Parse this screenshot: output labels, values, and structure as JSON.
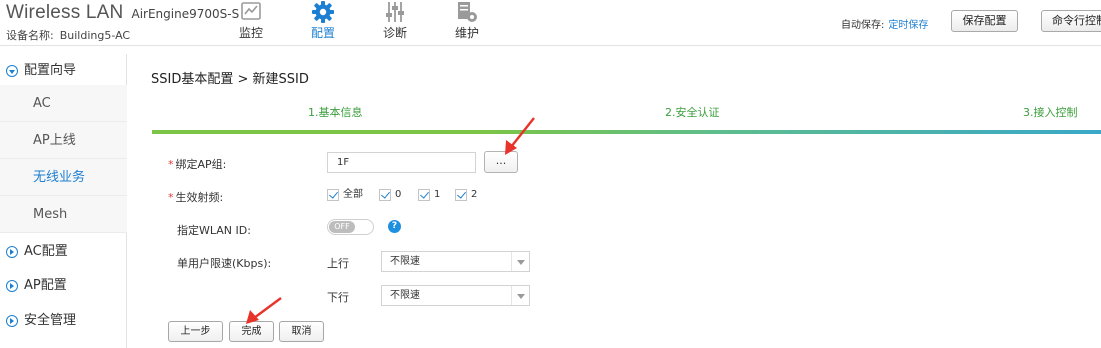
{
  "header": {
    "brand": "Wireless LAN",
    "model": "AirEngine9700S-S",
    "device_name_label": "设备名称:",
    "device_name": "Building5-AC",
    "nav": [
      {
        "label": "监控",
        "icon": "monitor-chart-icon"
      },
      {
        "label": "配置",
        "icon": "gear-icon",
        "active": true
      },
      {
        "label": "诊断",
        "icon": "sliders-icon"
      },
      {
        "label": "维护",
        "icon": "maintenance-gear-icon"
      }
    ],
    "autosave_label": "自动保存:",
    "autosave_link": "定时保存",
    "save_config": "保存配置",
    "cli": "命令行控制"
  },
  "sidebar": {
    "groups": [
      {
        "label": "配置向导",
        "expanded": true
      },
      {
        "label": "AC配置"
      },
      {
        "label": "AP配置"
      },
      {
        "label": "安全管理"
      }
    ],
    "items": [
      {
        "label": "AC"
      },
      {
        "label": "AP上线"
      },
      {
        "label": "无线业务",
        "active": true
      },
      {
        "label": "Mesh"
      }
    ]
  },
  "main": {
    "breadcrumb": "SSID基本配置 > 新建SSID",
    "steps": [
      "1.基本信息",
      "2.安全认证",
      "3.接入控制"
    ],
    "form": {
      "ap_group_label": "绑定AP组:",
      "ap_group_value": "1F",
      "browse_label": "...",
      "radio_label": "生效射频:",
      "radios": [
        "全部",
        "0",
        "1",
        "2"
      ],
      "wlan_id_label": "指定WLAN ID:",
      "toggle_text": "OFF",
      "help": "?",
      "rate_label": "单用户限速(Kbps):",
      "up_label": "上行",
      "up_value": "不限速",
      "down_label": "下行",
      "down_value": "不限速"
    },
    "buttons": {
      "prev": "上一步",
      "finish": "完成",
      "cancel": "取消"
    }
  },
  "colors": {
    "accent": "#1c7fd1",
    "step_green": "#3a9e3a",
    "required": "#e53935",
    "annotation_arrow": "#e8332a"
  }
}
